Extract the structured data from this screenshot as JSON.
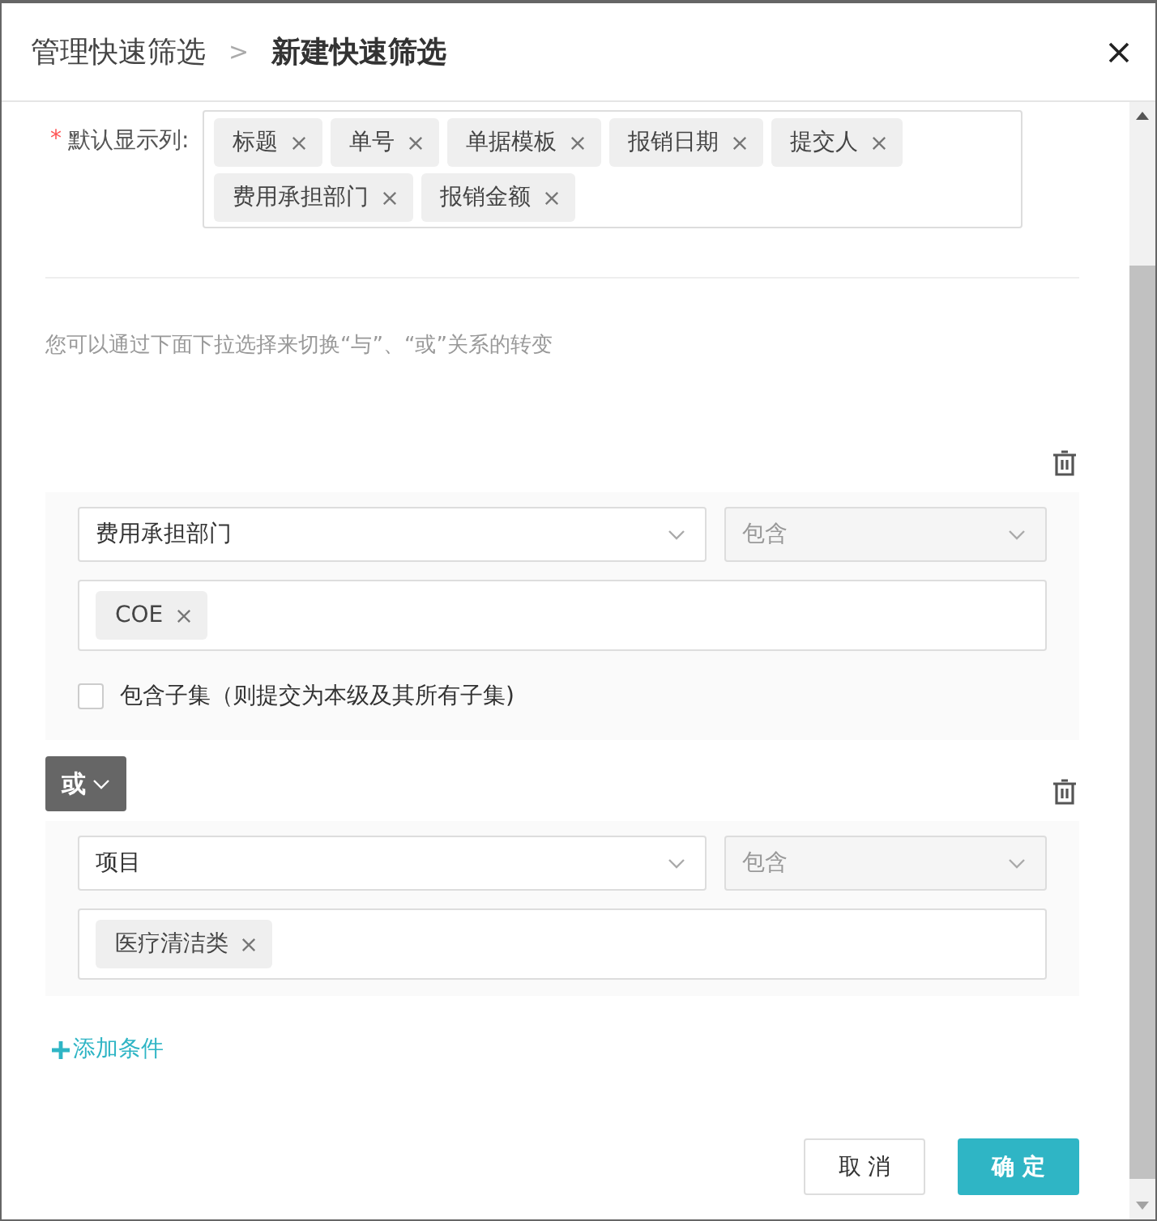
{
  "header": {
    "breadcrumb": "管理快速筛选",
    "separator": ">",
    "title": "新建快速筛选"
  },
  "default_columns": {
    "required_mark": "*",
    "label": "默认显示列:",
    "tags": [
      "标题",
      "单号",
      "单据模板",
      "报销日期",
      "提交人",
      "费用承担部门",
      "报销金额"
    ]
  },
  "hint": "您可以通过下面下拉选择来切换“与”、“或”关系的转变",
  "conditions": [
    {
      "field": "费用承担部门",
      "operator": "包含",
      "operator_disabled": true,
      "values": [
        "COE"
      ],
      "checkbox": {
        "label": "包含子集（则提交为本级及其所有子集)",
        "checked": false
      }
    },
    {
      "connector": "或",
      "field": "项目",
      "operator": "包含",
      "operator_disabled": true,
      "values": [
        "医疗清洁类"
      ]
    }
  ],
  "add_condition": "添加条件",
  "buttons": [
    {
      "label": "取 消",
      "kind": "secondary"
    },
    {
      "label": "确 定",
      "kind": "primary"
    }
  ]
}
